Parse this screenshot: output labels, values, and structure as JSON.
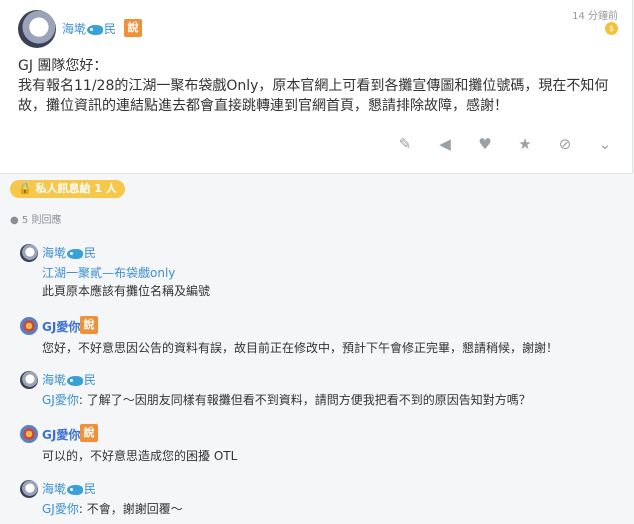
{
  "post": {
    "author": "海墘",
    "author_suffix": "民",
    "badge": "說",
    "time": "14 分鐘前",
    "greeting": "GJ 團隊您好：",
    "body": "我有報名11/28的江湖一聚布袋戲Only，原本官網上可看到各攤宣傳圖和攤位號碼，現在不知何故，攤位資訊的連結點進去都會直接跳轉連到官網首頁，懇請排除故障，感謝！",
    "actions": [
      "edit-icon",
      "bell-icon",
      "heart-icon",
      "star-icon",
      "block-icon",
      "chevron-down-icon"
    ]
  },
  "private_pill": "私人訊息給 1 人",
  "reply_count": "5 則回應",
  "comments": [
    {
      "author": "海墘",
      "suffix": "民",
      "link": "江湖一聚貳—布袋戲only",
      "text": "此頁原本應該有攤位名稱及編號"
    },
    {
      "author": "GJ愛你",
      "badge": "說",
      "text": "您好，不好意思因公告的資料有誤，故目前正在修改中，預計下午會修正完畢，懇請稍候，謝謝！"
    },
    {
      "author": "海墘",
      "suffix": "民",
      "mention": "GJ愛你",
      "text": ": 了解了～因朋友同樣有報攤但看不到資料，請問方便我把看不到的原因告知對方嗎？"
    },
    {
      "author": "GJ愛你",
      "badge": "說",
      "text": "可以的，不好意思造成您的困擾 OTL"
    },
    {
      "author": "海墘",
      "suffix": "民",
      "mention": "GJ愛你",
      "text": ": 不會，謝謝回覆～"
    }
  ]
}
